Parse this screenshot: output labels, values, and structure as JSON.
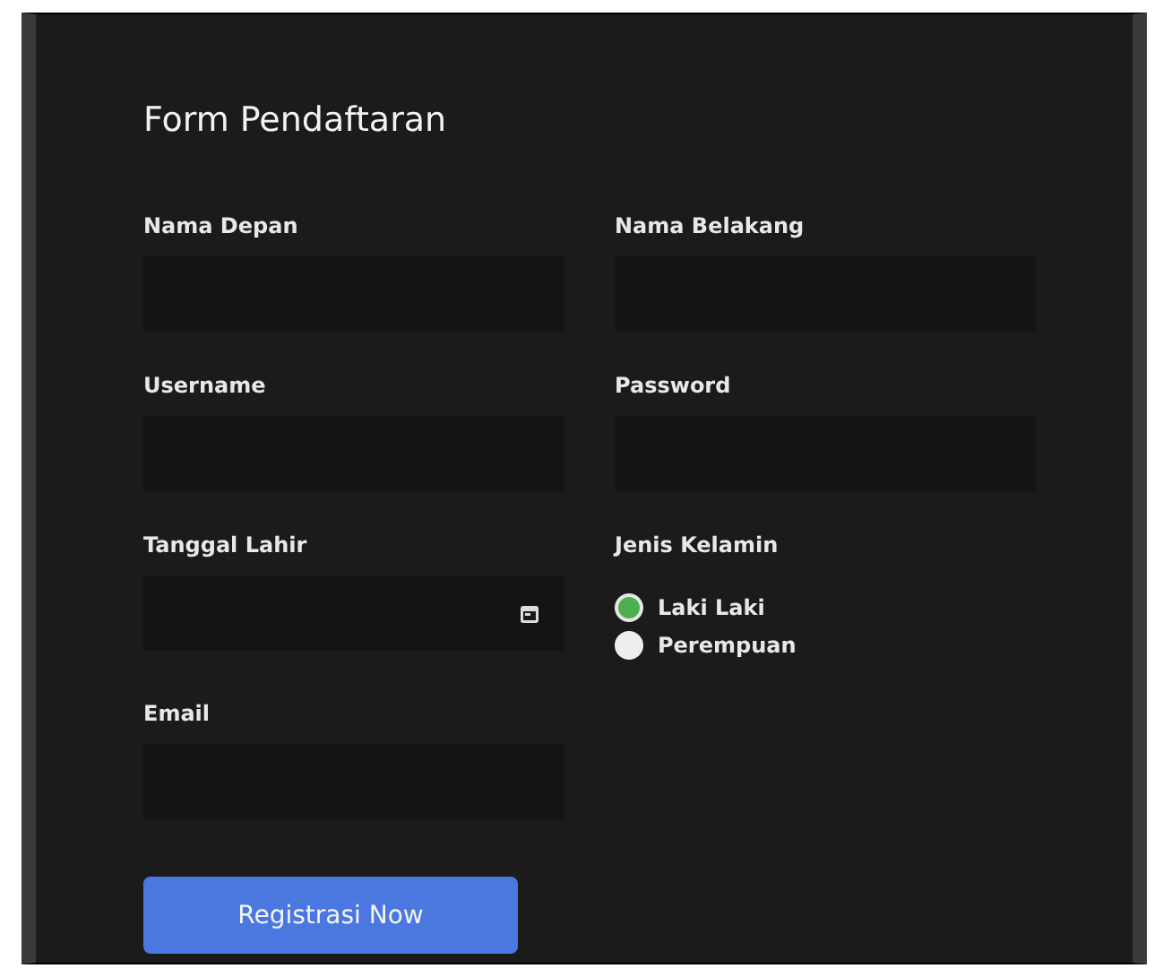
{
  "title": "Form Pendaftaran",
  "fields": [
    {
      "label": "Nama Depan",
      "kind": "text"
    },
    {
      "label": "Nama Belakang",
      "kind": "text"
    },
    {
      "label": "Username",
      "kind": "text"
    },
    {
      "label": "Password",
      "kind": "text"
    },
    {
      "label": "Tanggal Lahir",
      "kind": "date"
    },
    {
      "label": "Jenis Kelamin",
      "kind": "radio",
      "options": [
        {
          "label": "Laki Laki",
          "selected": true
        },
        {
          "label": "Perempuan",
          "selected": false
        }
      ]
    },
    {
      "label": "Email",
      "kind": "text"
    }
  ],
  "button": "Registrasi Now"
}
